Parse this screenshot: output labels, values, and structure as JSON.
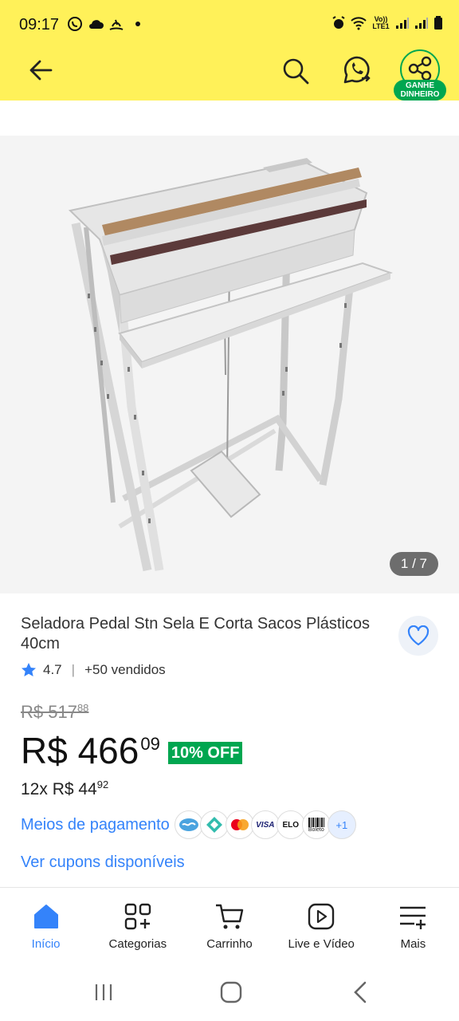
{
  "status_bar": {
    "time": "09:17",
    "network": "Vo)) LTE1"
  },
  "header": {
    "share_badge": "GANHE DINHEIRO"
  },
  "gallery": {
    "counter": "1 / 7"
  },
  "product": {
    "title": "Seladora Pedal Stn Sela E Corta Sacos Plásticos 40cm",
    "rating": "4.7",
    "sold": "+50 vendidos",
    "old_price_main": "R$ 517",
    "old_price_cents": "88",
    "price_main": "R$ 466",
    "price_cents": "09",
    "discount": "10% OFF",
    "installment_main": "12x R$ 44",
    "installment_cents": "92",
    "payment_label": "Meios de pagamento",
    "payment_methods": [
      "VISA",
      "ELO",
      "Boleto"
    ],
    "payment_more": "+1",
    "coupons_link": "Ver cupons disponíveis"
  },
  "nav": [
    {
      "label": "Início",
      "active": true
    },
    {
      "label": "Categorias"
    },
    {
      "label": "Carrinho"
    },
    {
      "label": "Live e Vídeo"
    },
    {
      "label": "Mais"
    }
  ],
  "colors": {
    "header_bg": "#fff159",
    "accent": "#3483fa",
    "green": "#00a650"
  }
}
